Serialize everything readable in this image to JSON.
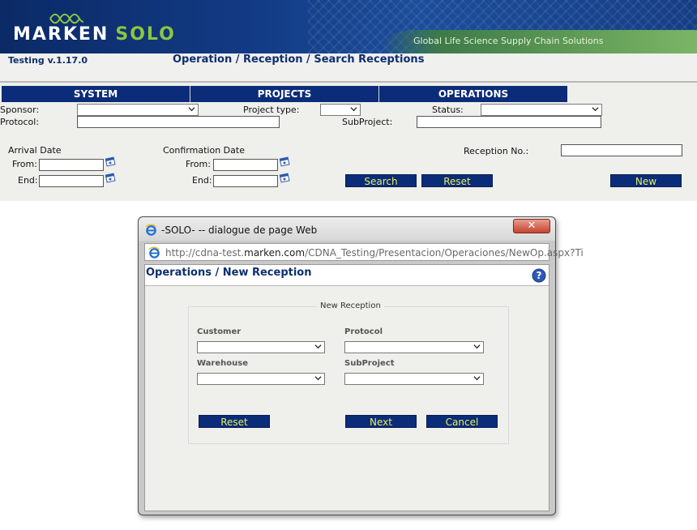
{
  "banner": {
    "brand_main": "MARKEN",
    "brand_sub": "SOLO",
    "tagline": "Global Life Science Supply Chain Solutions",
    "colors": {
      "navy": "#0b2a66",
      "green": "#8cc63f"
    }
  },
  "header": {
    "version": "Testing v.1.17.0",
    "breadcrumb": "Operation / Reception / Search Receptions"
  },
  "nav": {
    "tabs": [
      {
        "label": "SYSTEM"
      },
      {
        "label": "PROJECTS"
      },
      {
        "label": "OPERATIONS"
      }
    ]
  },
  "search_form": {
    "sponsor_label": "Sponsor:",
    "sponsor_value": "",
    "project_type_label": "Project type:",
    "project_type_value": "",
    "status_label": "Status:",
    "status_value": "",
    "protocol_label": "Protocol:",
    "protocol_value": "",
    "subproject_label": "SubProject:",
    "subproject_value": "",
    "arrival_date_label": "Arrival Date",
    "arrival_from_label": "From:",
    "arrival_end_label": "End:",
    "confirmation_date_label": "Confirmation Date",
    "confirmation_from_label": "From:",
    "confirmation_end_label": "End:",
    "reception_no_label": "Reception No.:",
    "reception_no_value": "",
    "search_label": "Search",
    "reset_label": "Reset",
    "new_label": "New",
    "button_color": "#0b2c78",
    "button_text_color": "#e9f05a"
  },
  "dialog": {
    "title": "-SOLO- -- dialogue de page Web",
    "close_label": "✕",
    "url_prefix": "http://cdna-test.",
    "url_domain": "marken.com",
    "url_suffix": "/CDNA_Testing/Presentacion/Operaciones/NewOp.aspx?Ti",
    "heading": "Operations / New Reception",
    "legend": "New Reception",
    "customer_label": "Customer",
    "customer_value": "",
    "protocol_label": "Protocol",
    "protocol_value": "",
    "warehouse_label": "Warehouse",
    "warehouse_value": "",
    "subproject_label": "SubProject",
    "subproject_value": "",
    "reset_label": "Reset",
    "next_label": "Next",
    "cancel_label": "Cancel"
  }
}
